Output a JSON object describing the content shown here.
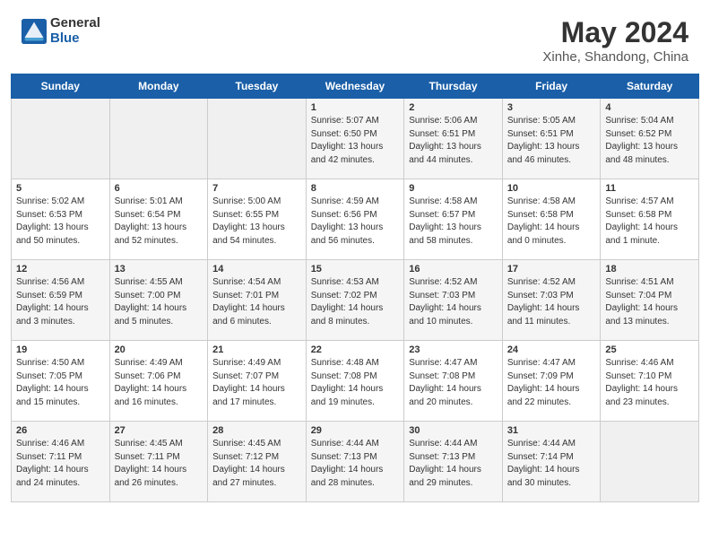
{
  "header": {
    "logo_general": "General",
    "logo_blue": "Blue",
    "month_year": "May 2024",
    "location": "Xinhe, Shandong, China"
  },
  "days_of_week": [
    "Sunday",
    "Monday",
    "Tuesday",
    "Wednesday",
    "Thursday",
    "Friday",
    "Saturday"
  ],
  "weeks": [
    [
      {
        "day": "",
        "info": ""
      },
      {
        "day": "",
        "info": ""
      },
      {
        "day": "",
        "info": ""
      },
      {
        "day": "1",
        "info": "Sunrise: 5:07 AM\nSunset: 6:50 PM\nDaylight: 13 hours\nand 42 minutes."
      },
      {
        "day": "2",
        "info": "Sunrise: 5:06 AM\nSunset: 6:51 PM\nDaylight: 13 hours\nand 44 minutes."
      },
      {
        "day": "3",
        "info": "Sunrise: 5:05 AM\nSunset: 6:51 PM\nDaylight: 13 hours\nand 46 minutes."
      },
      {
        "day": "4",
        "info": "Sunrise: 5:04 AM\nSunset: 6:52 PM\nDaylight: 13 hours\nand 48 minutes."
      }
    ],
    [
      {
        "day": "5",
        "info": "Sunrise: 5:02 AM\nSunset: 6:53 PM\nDaylight: 13 hours\nand 50 minutes."
      },
      {
        "day": "6",
        "info": "Sunrise: 5:01 AM\nSunset: 6:54 PM\nDaylight: 13 hours\nand 52 minutes."
      },
      {
        "day": "7",
        "info": "Sunrise: 5:00 AM\nSunset: 6:55 PM\nDaylight: 13 hours\nand 54 minutes."
      },
      {
        "day": "8",
        "info": "Sunrise: 4:59 AM\nSunset: 6:56 PM\nDaylight: 13 hours\nand 56 minutes."
      },
      {
        "day": "9",
        "info": "Sunrise: 4:58 AM\nSunset: 6:57 PM\nDaylight: 13 hours\nand 58 minutes."
      },
      {
        "day": "10",
        "info": "Sunrise: 4:58 AM\nSunset: 6:58 PM\nDaylight: 14 hours\nand 0 minutes."
      },
      {
        "day": "11",
        "info": "Sunrise: 4:57 AM\nSunset: 6:58 PM\nDaylight: 14 hours\nand 1 minute."
      }
    ],
    [
      {
        "day": "12",
        "info": "Sunrise: 4:56 AM\nSunset: 6:59 PM\nDaylight: 14 hours\nand 3 minutes."
      },
      {
        "day": "13",
        "info": "Sunrise: 4:55 AM\nSunset: 7:00 PM\nDaylight: 14 hours\nand 5 minutes."
      },
      {
        "day": "14",
        "info": "Sunrise: 4:54 AM\nSunset: 7:01 PM\nDaylight: 14 hours\nand 6 minutes."
      },
      {
        "day": "15",
        "info": "Sunrise: 4:53 AM\nSunset: 7:02 PM\nDaylight: 14 hours\nand 8 minutes."
      },
      {
        "day": "16",
        "info": "Sunrise: 4:52 AM\nSunset: 7:03 PM\nDaylight: 14 hours\nand 10 minutes."
      },
      {
        "day": "17",
        "info": "Sunrise: 4:52 AM\nSunset: 7:03 PM\nDaylight: 14 hours\nand 11 minutes."
      },
      {
        "day": "18",
        "info": "Sunrise: 4:51 AM\nSunset: 7:04 PM\nDaylight: 14 hours\nand 13 minutes."
      }
    ],
    [
      {
        "day": "19",
        "info": "Sunrise: 4:50 AM\nSunset: 7:05 PM\nDaylight: 14 hours\nand 15 minutes."
      },
      {
        "day": "20",
        "info": "Sunrise: 4:49 AM\nSunset: 7:06 PM\nDaylight: 14 hours\nand 16 minutes."
      },
      {
        "day": "21",
        "info": "Sunrise: 4:49 AM\nSunset: 7:07 PM\nDaylight: 14 hours\nand 17 minutes."
      },
      {
        "day": "22",
        "info": "Sunrise: 4:48 AM\nSunset: 7:08 PM\nDaylight: 14 hours\nand 19 minutes."
      },
      {
        "day": "23",
        "info": "Sunrise: 4:47 AM\nSunset: 7:08 PM\nDaylight: 14 hours\nand 20 minutes."
      },
      {
        "day": "24",
        "info": "Sunrise: 4:47 AM\nSunset: 7:09 PM\nDaylight: 14 hours\nand 22 minutes."
      },
      {
        "day": "25",
        "info": "Sunrise: 4:46 AM\nSunset: 7:10 PM\nDaylight: 14 hours\nand 23 minutes."
      }
    ],
    [
      {
        "day": "26",
        "info": "Sunrise: 4:46 AM\nSunset: 7:11 PM\nDaylight: 14 hours\nand 24 minutes."
      },
      {
        "day": "27",
        "info": "Sunrise: 4:45 AM\nSunset: 7:11 PM\nDaylight: 14 hours\nand 26 minutes."
      },
      {
        "day": "28",
        "info": "Sunrise: 4:45 AM\nSunset: 7:12 PM\nDaylight: 14 hours\nand 27 minutes."
      },
      {
        "day": "29",
        "info": "Sunrise: 4:44 AM\nSunset: 7:13 PM\nDaylight: 14 hours\nand 28 minutes."
      },
      {
        "day": "30",
        "info": "Sunrise: 4:44 AM\nSunset: 7:13 PM\nDaylight: 14 hours\nand 29 minutes."
      },
      {
        "day": "31",
        "info": "Sunrise: 4:44 AM\nSunset: 7:14 PM\nDaylight: 14 hours\nand 30 minutes."
      },
      {
        "day": "",
        "info": ""
      }
    ]
  ]
}
